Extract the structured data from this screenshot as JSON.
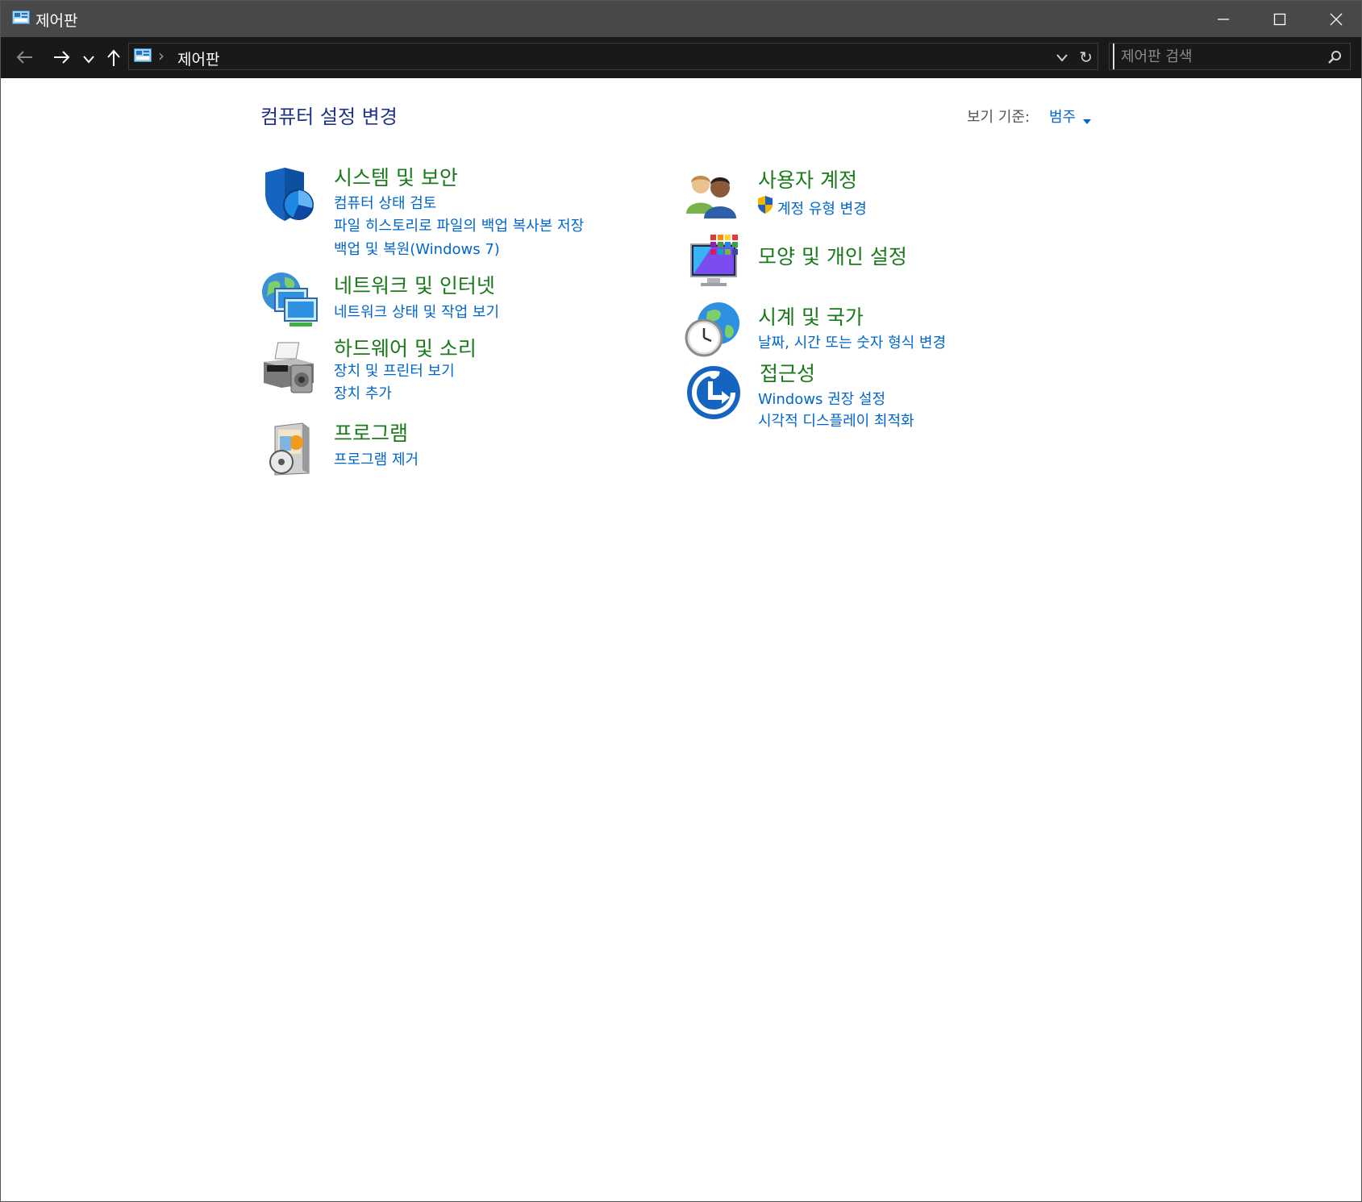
{
  "window": {
    "title": "제어판"
  },
  "nav": {
    "breadcrumb": "제어판",
    "search_placeholder": "제어판 검색"
  },
  "content": {
    "heading": "컴퓨터 설정 변경",
    "view_by_label": "보기 기준:",
    "view_by_value": "범주"
  },
  "categories": {
    "system": {
      "title": "시스템 및 보안",
      "links": [
        "컴퓨터 상태 검토",
        "파일 히스토리로 파일의 백업 복사본 저장",
        "백업 및 복원(Windows 7)"
      ]
    },
    "network": {
      "title": "네트워크 및 인터넷",
      "links": [
        "네트워크 상태 및 작업 보기"
      ]
    },
    "hardware": {
      "title": "하드웨어 및 소리",
      "links": [
        "장치 및 프린터 보기",
        "장치 추가"
      ]
    },
    "programs": {
      "title": "프로그램",
      "links": [
        "프로그램 제거"
      ]
    },
    "users": {
      "title": "사용자 계정",
      "links": [
        "계정 유형 변경"
      ]
    },
    "appearance": {
      "title": "모양 및 개인 설정",
      "links": []
    },
    "clock": {
      "title": "시계 및 국가",
      "links": [
        "날짜, 시간 또는 숫자 형식 변경"
      ]
    },
    "access": {
      "title": "접근성",
      "links": [
        "Windows 권장 설정",
        "시각적 디스플레이 최적화"
      ]
    }
  },
  "colors": {
    "heading": "#1e3287",
    "category_title": "#1a7a1a",
    "link": "#0066cc",
    "titlebar": "#484848",
    "navbar": "#191919"
  },
  "icons": [
    "control-panel-icon",
    "back-arrow-icon",
    "forward-arrow-icon",
    "chevron-down-icon",
    "up-arrow-icon",
    "refresh-icon",
    "search-icon",
    "shield-icon",
    "network-icon",
    "printer-icon",
    "programs-icon",
    "users-icon",
    "appearance-icon",
    "clock-globe-icon",
    "accessibility-icon",
    "uac-shield-icon"
  ]
}
